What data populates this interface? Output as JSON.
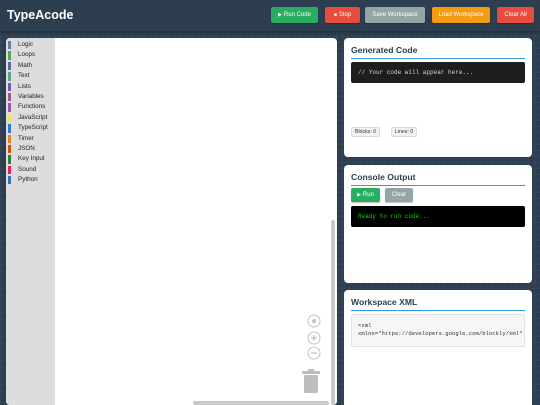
{
  "app": {
    "title": "TypeAcode"
  },
  "toolbar": {
    "run_code": "Run Code",
    "stop": "Stop",
    "save_workspace": "Save Workspace",
    "load_workspace": "Load Workspace",
    "clear_all": "Clear All"
  },
  "colors": {
    "background": "#2c3e50",
    "run_green": "#27ae60",
    "stop_red": "#e74c3c",
    "save_gray": "#95a5a6",
    "load_orange": "#f39c12",
    "accent_blue": "#3498db"
  },
  "toolbox": {
    "categories": [
      {
        "label": "Logic",
        "color": "#5b80a5"
      },
      {
        "label": "Loops",
        "color": "#5ba55b"
      },
      {
        "label": "Math",
        "color": "#5b67a5"
      },
      {
        "label": "Text",
        "color": "#5ba58c"
      },
      {
        "label": "Lists",
        "color": "#745ba5"
      },
      {
        "label": "Variables",
        "color": "#a55b80"
      },
      {
        "label": "Functions",
        "color": "#995ba5"
      },
      {
        "label": "JavaScript",
        "color": "#f1e05a"
      },
      {
        "label": "TypeScript",
        "color": "#3178c6"
      },
      {
        "label": "Timer",
        "color": "#e67e22"
      },
      {
        "label": "JSON",
        "color": "#d35400"
      },
      {
        "label": "Key Input",
        "color": "#2e7d32"
      },
      {
        "label": "Sound",
        "color": "#e91e63"
      },
      {
        "label": "Python",
        "color": "#3572a5"
      }
    ]
  },
  "generated_code": {
    "title": "Generated Code",
    "placeholder": "// Your code will appear here...",
    "blocks_label": "Blocks: 0",
    "lines_label": "Lines: 0"
  },
  "console": {
    "title": "Console Output",
    "run_label": "Run",
    "clear_label": "Clear",
    "output": "Ready to run code..."
  },
  "workspace_xml": {
    "title": "Workspace XML",
    "line1": "<xml",
    "line2": "xmlns=\"https://developers.google.com/blockly/xml\""
  }
}
